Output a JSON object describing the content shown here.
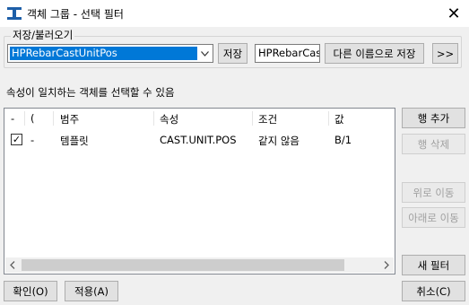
{
  "window": {
    "title": "객체 그룹 - 선택 필터",
    "close_glyph": "✕"
  },
  "save_group": {
    "label": "저장/불러오기",
    "preset_value": "HPRebarCastUnitPos",
    "save_label": "저장",
    "filename_value": "HPRebarCast",
    "save_as_label": "다른 이름으로 저장",
    "more_label": ">>"
  },
  "hint": "속성이 일치하는 객체를 선택할 수 있음",
  "grid": {
    "columns": [
      "-",
      "(",
      "범주",
      "속성",
      "조건",
      "값"
    ],
    "rows": [
      {
        "checked": true,
        "check_glyph": "✓",
        "paren": "-",
        "category": "템플릿",
        "property": "CAST.UNIT.POS",
        "condition": "같지 않음",
        "value": "B/1"
      }
    ]
  },
  "side_buttons": {
    "add_row": "행 추가",
    "delete_row": "행 삭제",
    "move_up": "위로 이동",
    "move_down": "아래로 이동",
    "new_filter": "새 필터"
  },
  "footer": {
    "ok": "확인(O)",
    "apply": "적용(A)",
    "cancel": "취소(C)"
  },
  "colors": {
    "selection": "#0078d7",
    "brand_icon": "#1e5fa8"
  },
  "icons": {
    "app": "app-icon",
    "close": "close-icon",
    "dropdown": "chevron-down-icon",
    "check": "checkbox-icon"
  }
}
